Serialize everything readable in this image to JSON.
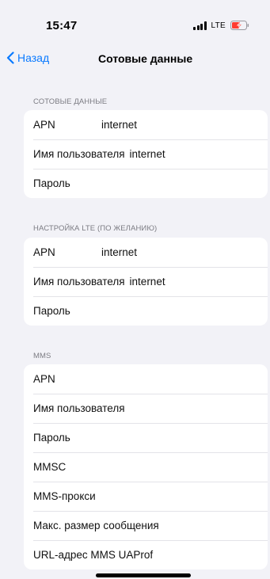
{
  "status_bar": {
    "time": "15:47",
    "network": "LTE",
    "signal_bars": 4,
    "battery": "charging"
  },
  "nav": {
    "back_label": "Назад",
    "title": "Сотовые данные"
  },
  "sections": {
    "cellular": {
      "header": "СОТОВЫЕ ДАННЫЕ",
      "apn_label": "APN",
      "apn_value": "internet",
      "user_label": "Имя пользователя",
      "user_value": "internet",
      "password_label": "Пароль"
    },
    "lte": {
      "header": "НАСТРОЙКА LTE (ПО ЖЕЛАНИЮ)",
      "apn_label": "APN",
      "apn_value": "internet",
      "user_label": "Имя пользователя",
      "user_value": "internet",
      "password_label": "Пароль"
    },
    "mms": {
      "header": "MMS",
      "rows": [
        "APN",
        "Имя пользователя",
        "Пароль",
        "MMSC",
        "MMS-прокси",
        "Макс. размер сообщения",
        "URL-адрес MMS UAProf"
      ]
    }
  },
  "colors": {
    "background": "#f2f2f7",
    "accent": "#0a7aff",
    "battery_charging": "#ff3b30"
  }
}
